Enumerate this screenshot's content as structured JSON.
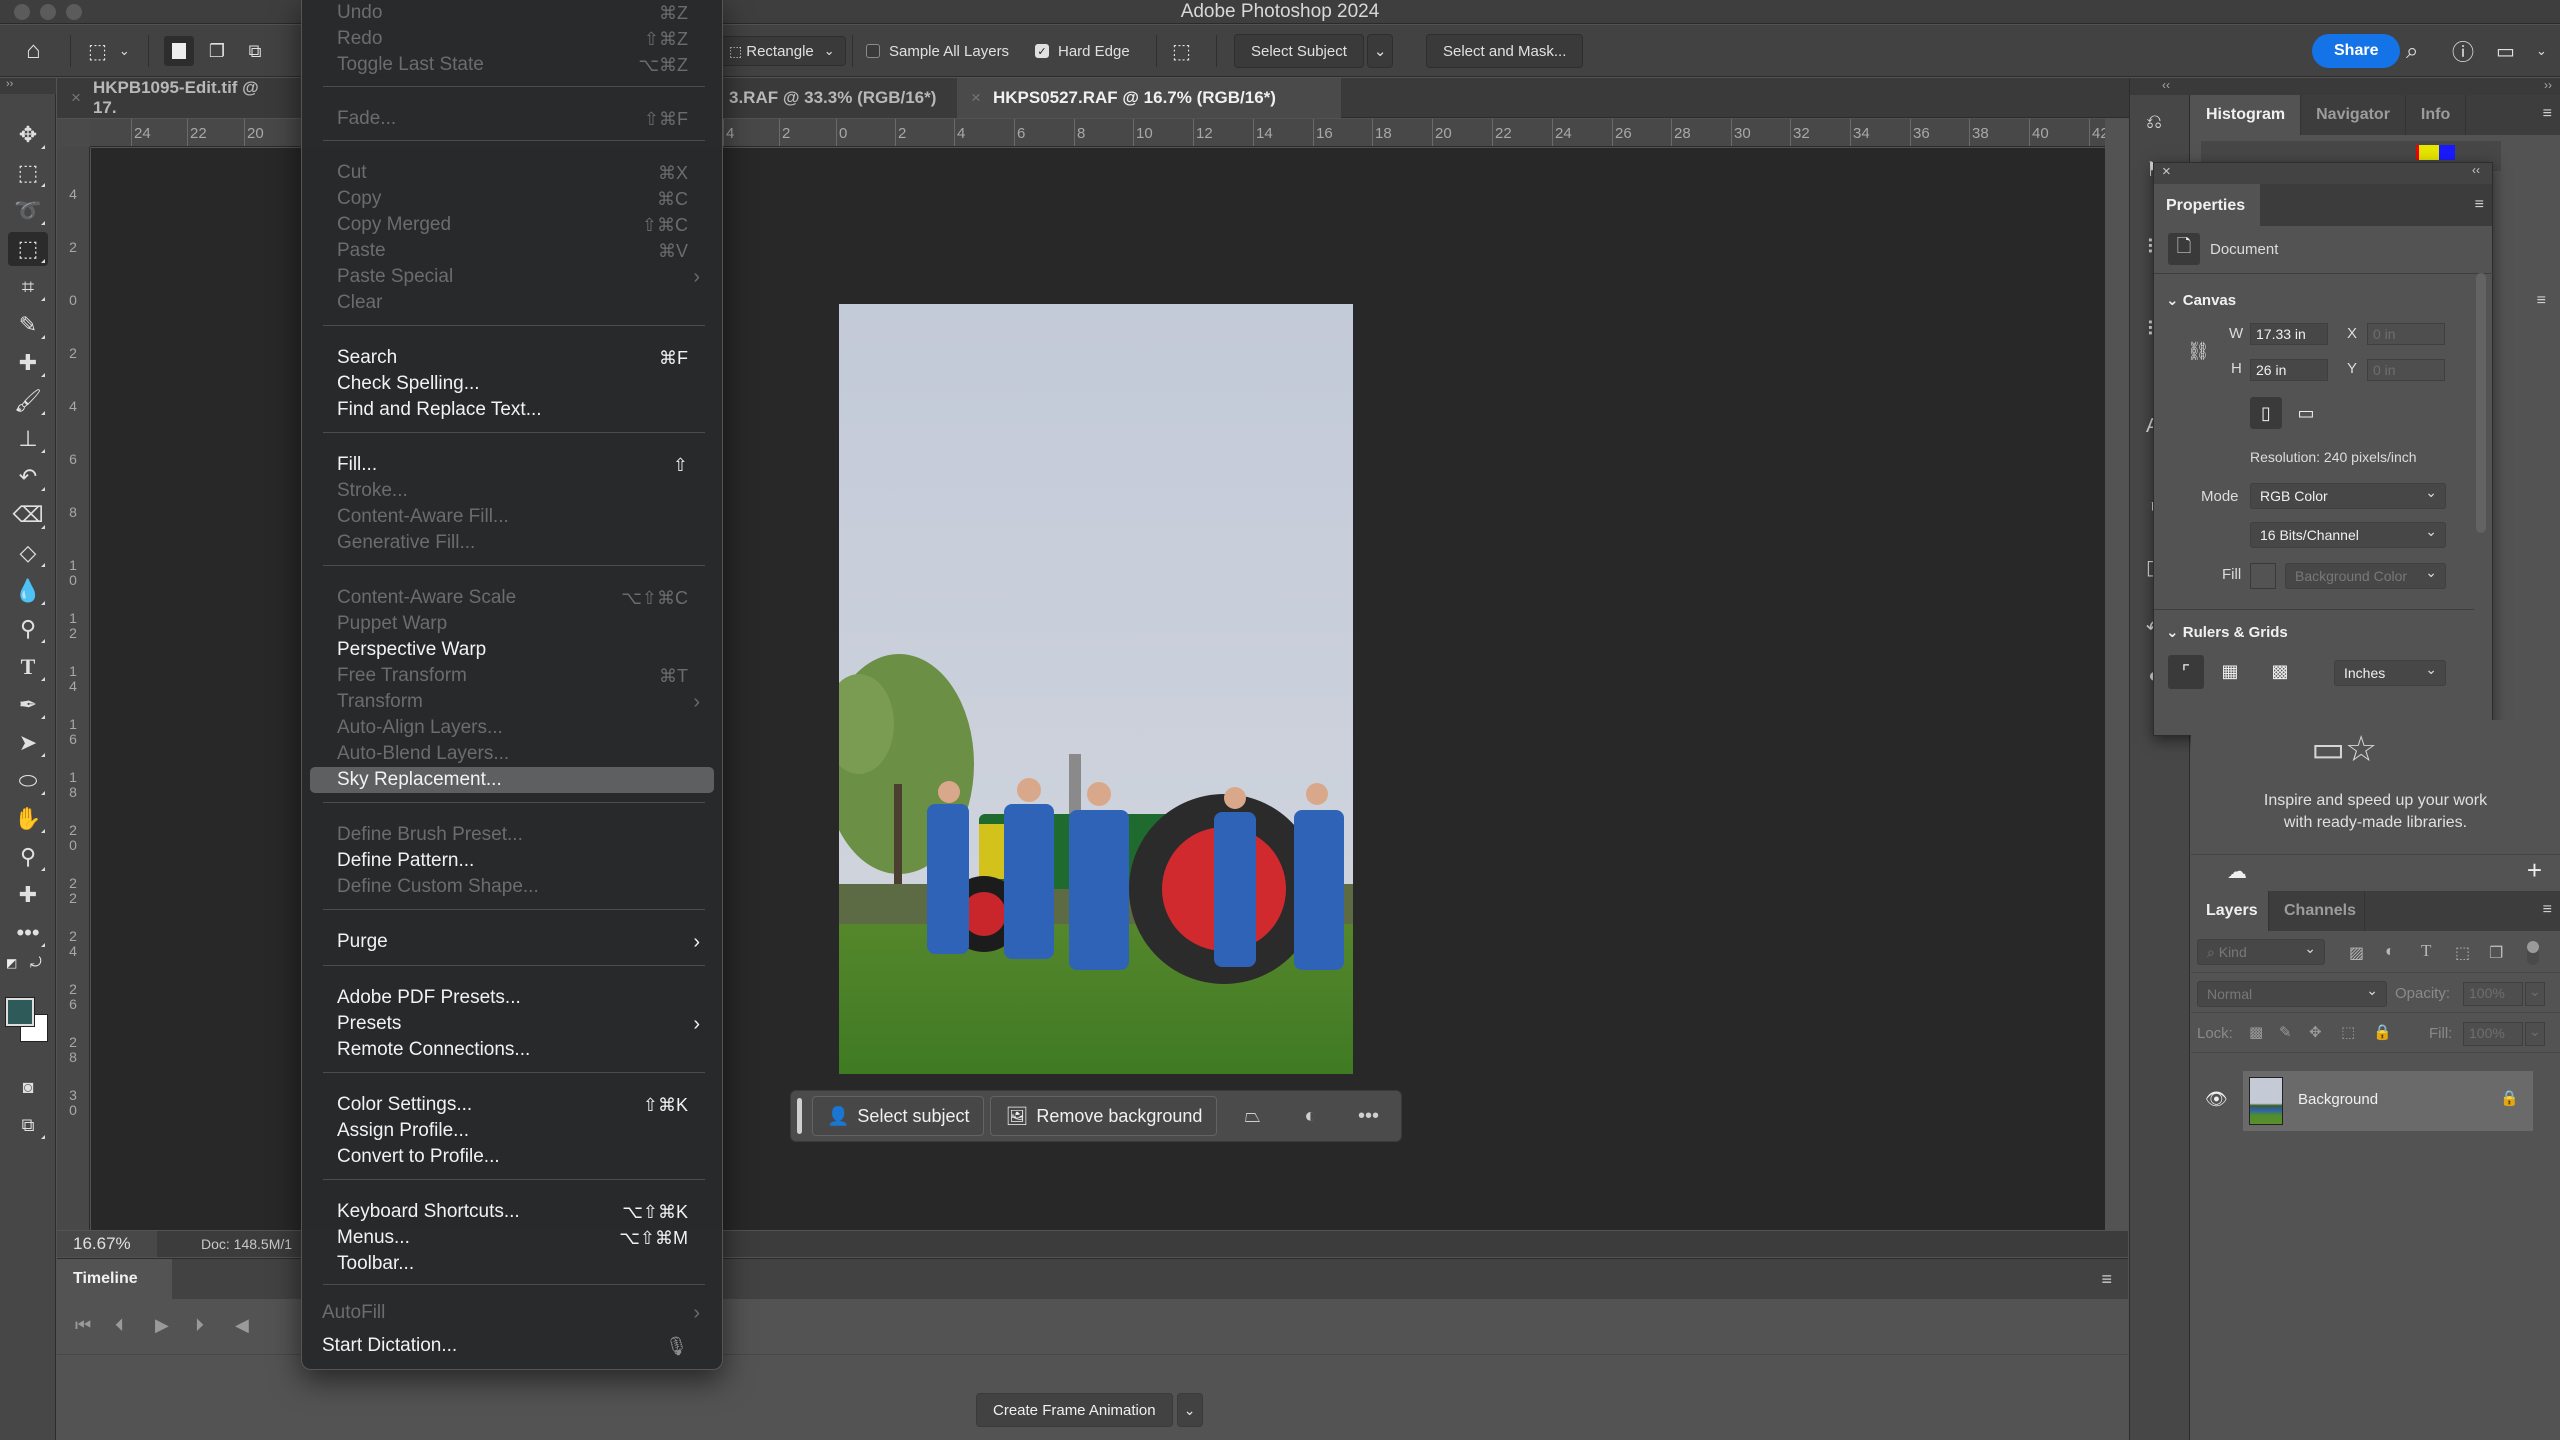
{
  "app": {
    "title": "Adobe Photoshop 2024"
  },
  "options_bar": {
    "shape_select": "Rectangle",
    "sample_all_layers": {
      "label": "Sample All Layers",
      "checked": false
    },
    "hard_edge": {
      "label": "Hard Edge",
      "checked": true
    },
    "select_subject": "Select Subject",
    "select_and_mask": "Select and Mask...",
    "share": "Share"
  },
  "doc_tabs": [
    {
      "label": "HKPB1095-Edit.tif @ 17.",
      "active": false
    },
    {
      "label": "3.RAF @ 33.3% (RGB/16*)",
      "active": false
    },
    {
      "label": "HKPS0527.RAF @ 16.7% (RGB/16*)",
      "active": true
    }
  ],
  "rulers": {
    "horizontal": [
      "24",
      "22",
      "20",
      "4",
      "2",
      "0",
      "2",
      "4",
      "6",
      "8",
      "10",
      "12",
      "14",
      "16",
      "18",
      "20",
      "22",
      "24",
      "26",
      "28",
      "30",
      "32",
      "34",
      "36",
      "38",
      "40",
      "42"
    ],
    "vertical": [
      "4",
      "2",
      "0",
      "2",
      "4",
      "6",
      "8",
      "10",
      "12",
      "14",
      "16",
      "18",
      "20",
      "22",
      "24",
      "26",
      "28",
      "30"
    ]
  },
  "taskbar": {
    "select_subject": "Select subject",
    "remove_background": "Remove background"
  },
  "status": {
    "zoom": "16.67%",
    "doc": "Doc: 148.5M/1"
  },
  "timeline": {
    "tab": "Timeline",
    "create_button": "Create Frame Animation"
  },
  "panels": {
    "top_tabs": [
      "Histogram",
      "Navigator",
      "Info"
    ],
    "properties": {
      "tab": "Properties",
      "type": "Document",
      "canvas_section": "Canvas",
      "w_label": "W",
      "w_value": "17.33 in",
      "h_label": "H",
      "h_value": "26 in",
      "x_label": "X",
      "x_value": "0 in",
      "y_label": "Y",
      "y_value": "0 in",
      "resolution": "Resolution: 240 pixels/inch",
      "mode_label": "Mode",
      "mode_value": "RGB Color",
      "bit_depth": "16 Bits/Channel",
      "fill_label": "Fill",
      "fill_value": "Background Color",
      "rulers_section": "Rulers & Grids",
      "units": "Inches"
    },
    "libraries": {
      "message_line1": "Inspire and speed up your work",
      "message_line2": "with ready-made libraries."
    },
    "layers": {
      "tabs": [
        "Layers",
        "Channels"
      ],
      "filter_kind": "Kind",
      "blend_mode": "Normal",
      "opacity_label": "Opacity:",
      "opacity_value": "100%",
      "lock_label": "Lock:",
      "fill_label": "Fill:",
      "fill_value": "100%",
      "items": [
        {
          "name": "Background",
          "visible": true,
          "locked": true
        }
      ]
    }
  },
  "edit_menu": {
    "items": [
      {
        "label": "Undo",
        "shortcut": "⌘Z",
        "enabled": false
      },
      {
        "label": "Redo",
        "shortcut": "⇧⌘Z",
        "enabled": false
      },
      {
        "label": "Toggle Last State",
        "shortcut": "⌥⌘Z",
        "enabled": false
      },
      {
        "label": "Fade...",
        "shortcut": "⇧⌘F",
        "enabled": false
      },
      {
        "label": "Cut",
        "shortcut": "⌘X",
        "enabled": false
      },
      {
        "label": "Copy",
        "shortcut": "⌘C",
        "enabled": false
      },
      {
        "label": "Copy Merged",
        "shortcut": "⇧⌘C",
        "enabled": false
      },
      {
        "label": "Paste",
        "shortcut": "⌘V",
        "enabled": false
      },
      {
        "label": "Paste Special",
        "shortcut": "",
        "enabled": false,
        "submenu": true
      },
      {
        "label": "Clear",
        "shortcut": "",
        "enabled": false
      },
      {
        "label": "Search",
        "shortcut": "⌘F",
        "enabled": true
      },
      {
        "label": "Check Spelling...",
        "shortcut": "",
        "enabled": true
      },
      {
        "label": "Find and Replace Text...",
        "shortcut": "",
        "enabled": true
      },
      {
        "label": "Fill...",
        "shortcut": "⇧",
        "enabled": true
      },
      {
        "label": "Stroke...",
        "shortcut": "",
        "enabled": false
      },
      {
        "label": "Content-Aware Fill...",
        "shortcut": "",
        "enabled": false
      },
      {
        "label": "Generative Fill...",
        "shortcut": "",
        "enabled": false
      },
      {
        "label": "Content-Aware Scale",
        "shortcut": "⌥⇧⌘C",
        "enabled": false
      },
      {
        "label": "Puppet Warp",
        "shortcut": "",
        "enabled": false
      },
      {
        "label": "Perspective Warp",
        "shortcut": "",
        "enabled": true
      },
      {
        "label": "Free Transform",
        "shortcut": "⌘T",
        "enabled": false
      },
      {
        "label": "Transform",
        "shortcut": "",
        "enabled": false,
        "submenu": true
      },
      {
        "label": "Auto-Align Layers...",
        "shortcut": "",
        "enabled": false
      },
      {
        "label": "Auto-Blend Layers...",
        "shortcut": "",
        "enabled": false
      },
      {
        "label": "Sky Replacement...",
        "shortcut": "",
        "enabled": true,
        "highlighted": true
      },
      {
        "label": "Define Brush Preset...",
        "shortcut": "",
        "enabled": false
      },
      {
        "label": "Define Pattern...",
        "shortcut": "",
        "enabled": true
      },
      {
        "label": "Define Custom Shape...",
        "shortcut": "",
        "enabled": false
      },
      {
        "label": "Purge",
        "shortcut": "",
        "enabled": true,
        "submenu": true
      },
      {
        "label": "Adobe PDF Presets...",
        "shortcut": "",
        "enabled": true
      },
      {
        "label": "Presets",
        "shortcut": "",
        "enabled": true,
        "submenu": true
      },
      {
        "label": "Remote Connections...",
        "shortcut": "",
        "enabled": true
      },
      {
        "label": "Color Settings...",
        "shortcut": "⇧⌘K",
        "enabled": true
      },
      {
        "label": "Assign Profile...",
        "shortcut": "",
        "enabled": true
      },
      {
        "label": "Convert to Profile...",
        "shortcut": "",
        "enabled": true
      },
      {
        "label": "Keyboard Shortcuts...",
        "shortcut": "⌥⇧⌘K",
        "enabled": true
      },
      {
        "label": "Menus...",
        "shortcut": "⌥⇧⌘M",
        "enabled": true
      },
      {
        "label": "Toolbar...",
        "shortcut": "",
        "enabled": true
      },
      {
        "label": "AutoFill",
        "shortcut": "",
        "enabled": false,
        "submenu": true
      },
      {
        "label": "Start Dictation...",
        "shortcut": "🎙",
        "enabled": true
      }
    ]
  },
  "colors": {
    "accent": "#1473e6",
    "foreground_swatch": "#2f5a5a",
    "background_swatch": "#ffffff"
  }
}
